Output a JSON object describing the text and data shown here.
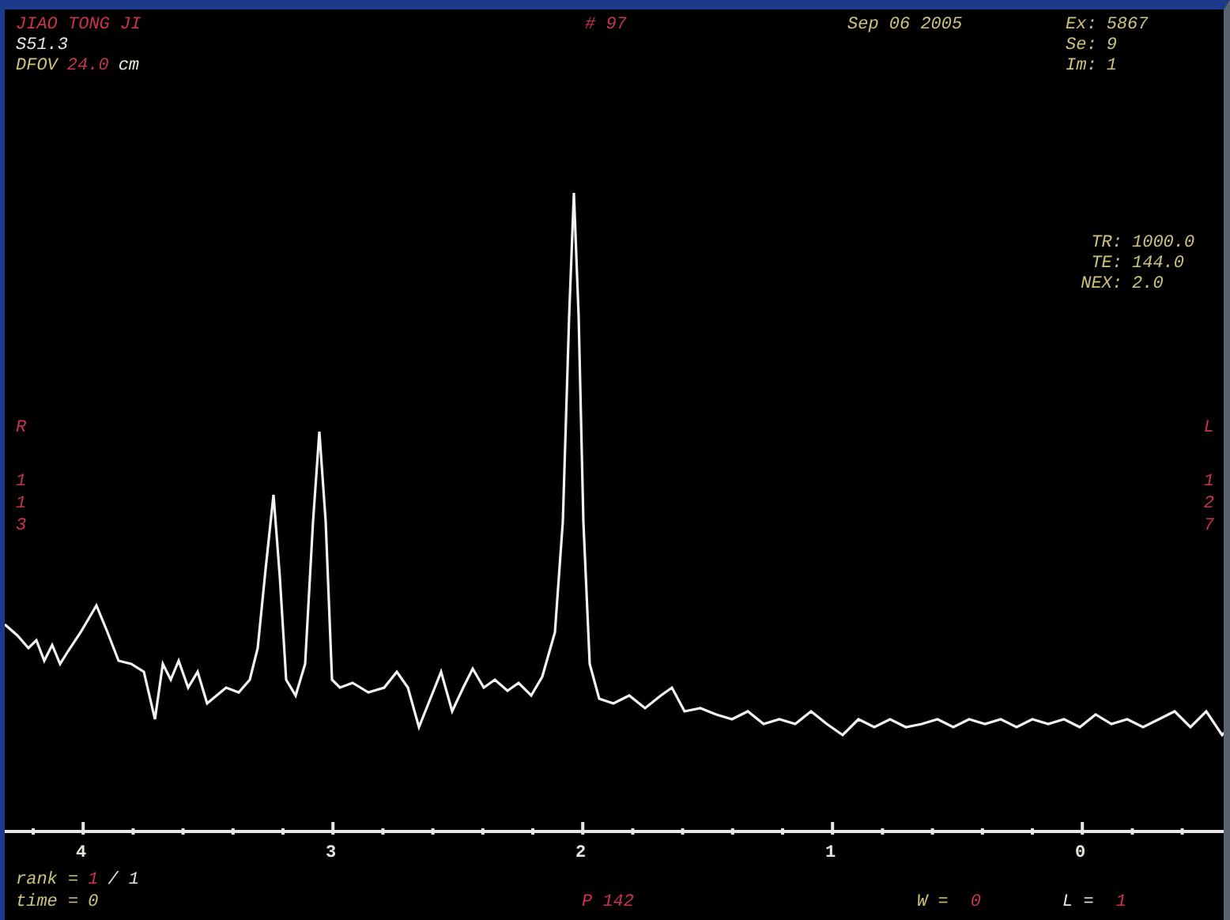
{
  "header": {
    "patient": "JIAO TONG JI",
    "exam_number": "# 97",
    "date": "Sep 06 2005",
    "location": "S51.3",
    "dfov": {
      "label": "DFOV",
      "value": "24.0",
      "unit": "cm"
    },
    "ids": [
      {
        "label": "Ex:",
        "value": "5867"
      },
      {
        "label": "Se:",
        "value": "9"
      },
      {
        "label": "Im:",
        "value": "1"
      }
    ]
  },
  "parameters": [
    {
      "label": "TR:",
      "value": "1000.0"
    },
    {
      "label": "TE:",
      "value": "144.0"
    },
    {
      "label": "NEX:",
      "value": "2.0"
    }
  ],
  "left_marker": {
    "letter": "R",
    "digits": [
      "1",
      "1",
      "3"
    ]
  },
  "right_marker": {
    "letter": "L",
    "digits": [
      "1",
      "2",
      "7"
    ]
  },
  "axis": {
    "labels": [
      "4",
      "3",
      "2",
      "1",
      "0"
    ]
  },
  "footer": {
    "rank": {
      "label": "rank =",
      "value": "1",
      "total": "/ 1"
    },
    "time": {
      "label": "time =",
      "value": "0"
    },
    "position": "P 142",
    "w_setting": {
      "label": "W =",
      "value": "0"
    },
    "l_setting": {
      "label": "L =",
      "value": "1"
    }
  }
}
